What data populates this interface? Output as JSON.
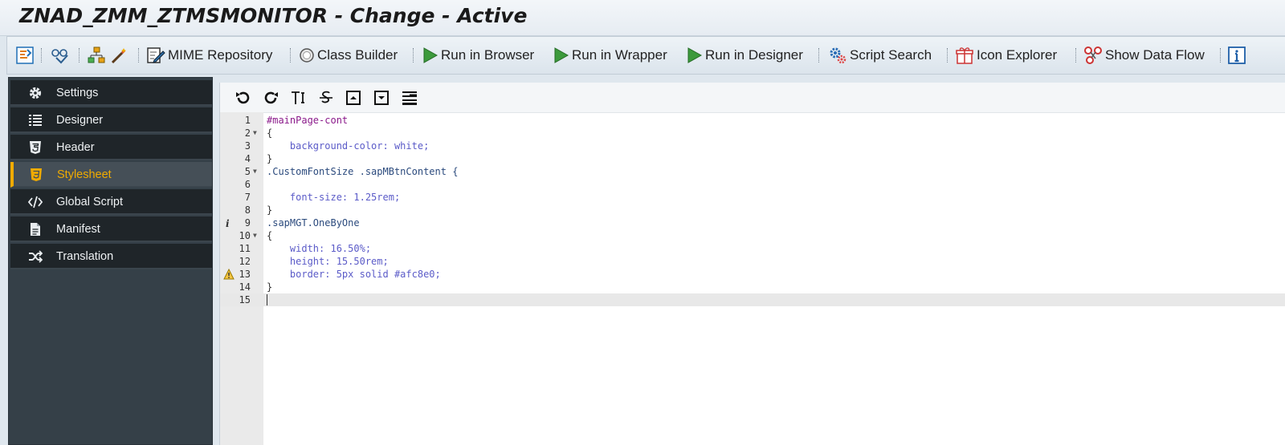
{
  "window": {
    "title": "ZNAD_ZMM_ZTMSMONITOR - Change - Active"
  },
  "toolbar": {
    "mime_label": "MIME Repository",
    "class_builder_label": "Class Builder",
    "run_browser_label": "Run in Browser",
    "run_wrapper_label": "Run in Wrapper",
    "run_designer_label": "Run in Designer",
    "script_search_label": "Script Search",
    "icon_explorer_label": "Icon Explorer",
    "show_data_flow_label": "Show Data Flow"
  },
  "sidebar": {
    "items": [
      {
        "label": "Settings",
        "icon": "gear-icon"
      },
      {
        "label": "Designer",
        "icon": "list-icon"
      },
      {
        "label": "Header",
        "icon": "html5-icon"
      },
      {
        "label": "Stylesheet",
        "icon": "css3-icon",
        "active": true
      },
      {
        "label": "Global Script",
        "icon": "code-icon"
      },
      {
        "label": "Manifest",
        "icon": "document-icon"
      },
      {
        "label": "Translation",
        "icon": "shuffle-icon"
      }
    ]
  },
  "editor": {
    "lines": [
      {
        "num": "1",
        "text": "#mainPage-cont"
      },
      {
        "num": "2",
        "text": "{"
      },
      {
        "num": "3",
        "text": "    background-color: white;"
      },
      {
        "num": "4",
        "text": "}"
      },
      {
        "num": "5",
        "text": ".CustomFontSize .sapMBtnContent {"
      },
      {
        "num": "6",
        "text": ""
      },
      {
        "num": "7",
        "text": "    font-size: 1.25rem;"
      },
      {
        "num": "8",
        "text": "}"
      },
      {
        "num": "9",
        "text": ".sapMGT.OneByOne"
      },
      {
        "num": "10",
        "text": "{"
      },
      {
        "num": "11",
        "text": "    width: 16.50%;"
      },
      {
        "num": "12",
        "text": "    height: 15.50rem;"
      },
      {
        "num": "13",
        "text": "    border: 5px solid #afc8e0;"
      },
      {
        "num": "14",
        "text": "}"
      },
      {
        "num": "15",
        "text": ""
      }
    ]
  },
  "colors": {
    "accent": "#f0ab00",
    "sidebar_bg": "#354048",
    "nav_bg": "#1f2529"
  }
}
